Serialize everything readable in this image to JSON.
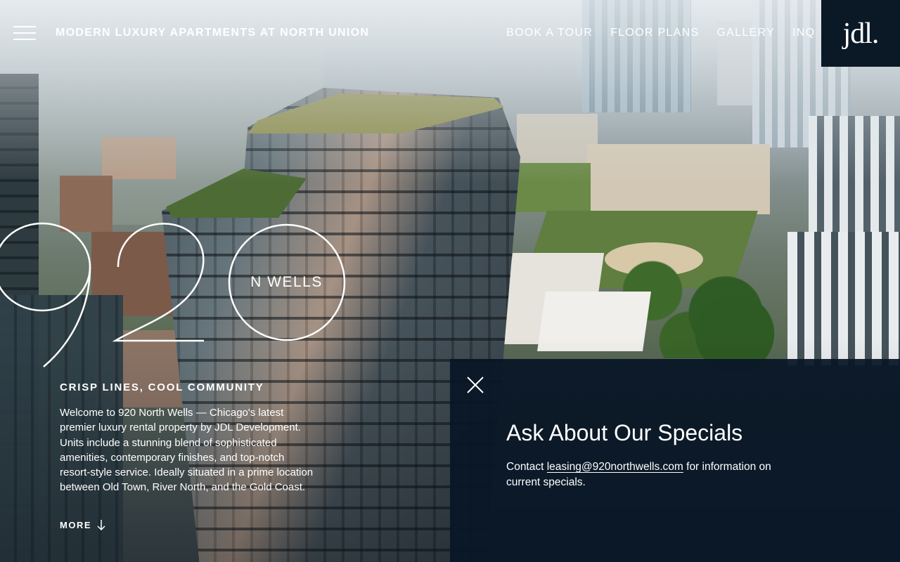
{
  "header": {
    "site_title": "MODERN LUXURY APARTMENTS AT NORTH UNION",
    "nav": [
      "BOOK A TOUR",
      "FLOOR PLANS",
      "GALLERY",
      "INQ"
    ],
    "logo_text": "jdl.",
    "menu_icon": "hamburger-menu-icon"
  },
  "hero": {
    "mark_digits": "920",
    "mark_label": "N WELLS",
    "tagline": "CRISP LINES, COOL COMMUNITY",
    "intro": "Welcome to 920 North Wells — Chicago's latest premier luxury rental property by JDL Development. Units include a stunning blend of sophisticated amenities, contemporary finishes, and top-notch resort-style service. Ideally situated in a prime location between Old Town, River North, and the Gold Coast.",
    "more_label": "MORE",
    "more_icon": "arrow-down-icon"
  },
  "specials": {
    "title": "Ask About Our Specials",
    "text_before": "Contact ",
    "email": "leasing@920northwells.com",
    "text_after": " for information on current specials.",
    "close_icon": "close-icon"
  },
  "colors": {
    "panel_bg": "#091626",
    "logo_bg": "#0b1826",
    "text": "#ffffff"
  }
}
